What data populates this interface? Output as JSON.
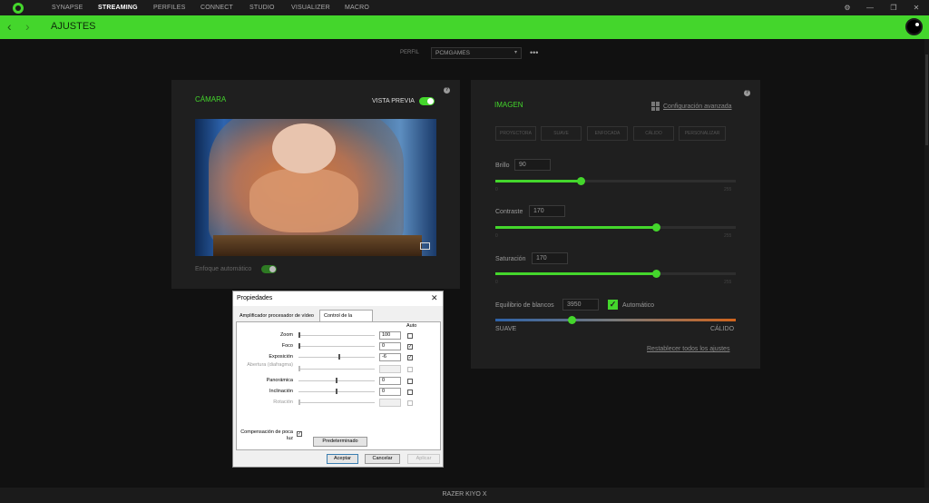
{
  "nav": {
    "items": [
      "SYNAPSE",
      "STREAMING",
      "PERFILES",
      "CONNECT",
      "STUDIO",
      "VISUALIZER",
      "MACRO"
    ],
    "active": "STREAMING"
  },
  "window_controls": {
    "settings": "⚙",
    "minimize": "—",
    "restore": "❐",
    "close": "✕"
  },
  "header": {
    "back": "‹",
    "forward": "›",
    "title": "AJUSTES"
  },
  "profile": {
    "label": "PERFIL",
    "selected": "PCMGAMES",
    "more": "•••"
  },
  "camera_panel": {
    "title": "CÁMARA",
    "preview_label": "VISTA PREVIA",
    "preview_on": true,
    "autofocus_label": "Enfoque automático",
    "autofocus_on": true,
    "help": "?"
  },
  "image_panel": {
    "title": "IMAGEN",
    "advanced_link": "Configuración avanzada",
    "help": "?",
    "presets": [
      "PROYECTORA",
      "SUAVE",
      "ENFOCADA",
      "CÁLIDO",
      "PERSONALIZAR"
    ],
    "brightness": {
      "label": "Brillo",
      "value": "90",
      "min": "0",
      "max": "255",
      "fraction": 0.353
    },
    "contrast": {
      "label": "Contraste",
      "value": "170",
      "min": "0",
      "max": "255",
      "fraction": 0.667
    },
    "saturation": {
      "label": "Saturación",
      "value": "170",
      "min": "0",
      "max": "255",
      "fraction": 0.667
    },
    "white_balance": {
      "label": "Equilibrio de blancos",
      "value": "3950",
      "auto_label": "Automático",
      "auto_checked": true,
      "check": "✓",
      "low_label": "SUAVE",
      "high_label": "CÁLIDO",
      "fraction": 0.317
    },
    "reset_link": "Restablecer todos los ajustes"
  },
  "dialog": {
    "title": "Propiedades",
    "close": "✕",
    "tabs": [
      "Amplificador procesador de vídeo",
      "Control de la cámara"
    ],
    "auto_header": "Auto",
    "rows": [
      {
        "label": "Zoom",
        "value": "100",
        "fraction": 0.0,
        "auto": false,
        "disabled": false
      },
      {
        "label": "Foco",
        "value": "0",
        "fraction": 0.0,
        "auto": true,
        "disabled": false
      },
      {
        "label": "Exposición",
        "value": "-6",
        "fraction": 0.54,
        "auto": true,
        "disabled": false
      },
      {
        "label": "Abertura (diafragma)",
        "value": "",
        "fraction": 0.0,
        "auto": false,
        "disabled": true
      },
      {
        "label": "Panorámica",
        "value": "0",
        "fraction": 0.5,
        "auto": false,
        "disabled": false
      },
      {
        "label": "Inclinación",
        "value": "0",
        "fraction": 0.5,
        "auto": false,
        "disabled": false
      },
      {
        "label": "Rotación",
        "value": "",
        "fraction": 0.0,
        "auto": false,
        "disabled": true
      }
    ],
    "check": "✓",
    "low_light_label": "Compensación de poca luz",
    "low_light_checked": true,
    "default_button": "Predeterminado",
    "ok_button": "Aceptar",
    "cancel_button": "Cancelar",
    "apply_button": "Aplicar"
  },
  "footer": {
    "device": "RAZER KIYO X"
  },
  "colors": {
    "accent": "#44d62c",
    "background": "#111111",
    "panel": "#1f1f1f"
  }
}
